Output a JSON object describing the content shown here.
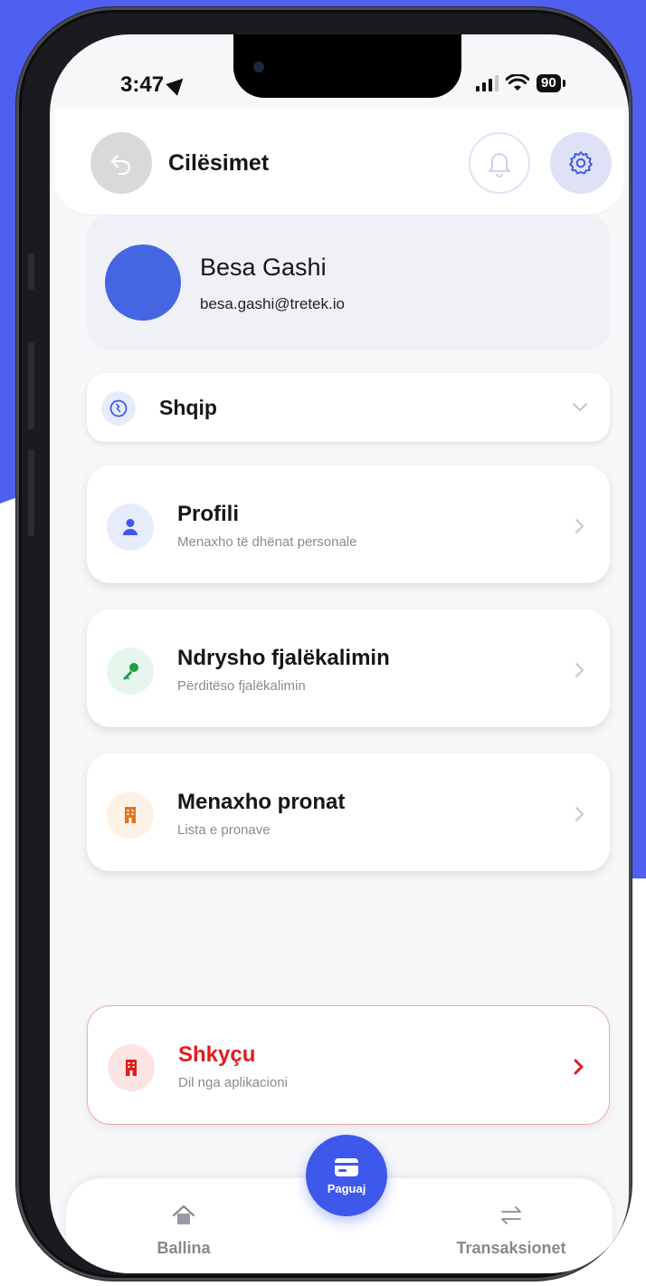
{
  "status_bar": {
    "time": "3:47",
    "battery": "90"
  },
  "header": {
    "title": "Cilësimet"
  },
  "profile": {
    "name": "Besa Gashi",
    "email": "besa.gashi@tretek.io"
  },
  "language": {
    "selected": "Shqip"
  },
  "menu": [
    {
      "title": "Profili",
      "subtitle": "Menaxho të dhënat personale"
    },
    {
      "title": "Ndrysho fjalëkalimin",
      "subtitle": "Përditëso fjalëkalimin"
    },
    {
      "title": "Menaxho pronat",
      "subtitle": "Lista e pronave"
    }
  ],
  "logout": {
    "title": "Shkyçu",
    "subtitle": "Dil nga aplikacioni"
  },
  "bottom_nav": {
    "home": "Ballina",
    "pay": "Paguaj",
    "transactions": "Transaksionet"
  },
  "colors": {
    "brand_blue": "#4f5ff0",
    "danger": "#e21c1c",
    "avatar": "#4566e2"
  },
  "icons": [
    "back-arrow-icon",
    "bell-icon",
    "gear-icon",
    "globe-icon",
    "chevron-down-icon",
    "user-icon",
    "key-icon",
    "building-icon",
    "chevron-right-icon",
    "card-icon",
    "home-icon",
    "transfer-icon"
  ]
}
